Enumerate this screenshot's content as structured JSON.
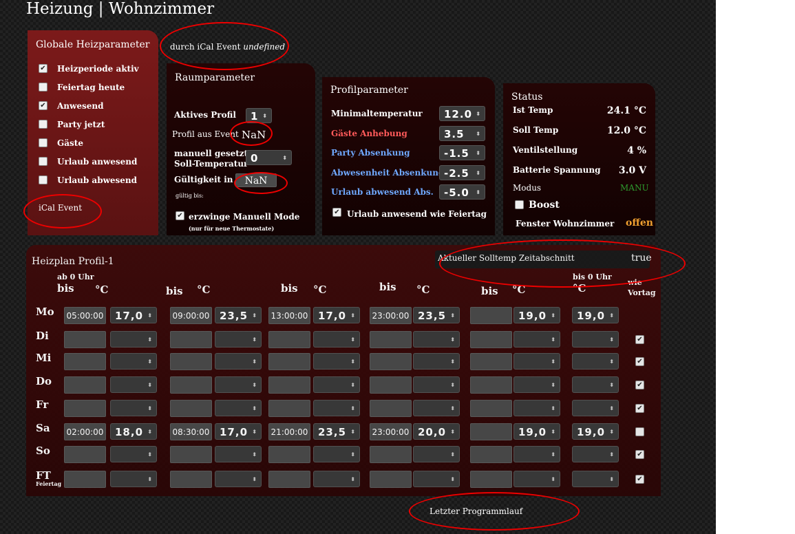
{
  "title": "Heizung | Wohnzimmer",
  "ical_event_top": {
    "prefix": "durch iCal Event",
    "value": "undefined"
  },
  "global": {
    "title": "Globale Heizparameter",
    "items": [
      {
        "label": "Heizperiode aktiv",
        "checked": true
      },
      {
        "label": "Feiertag heute",
        "checked": false
      },
      {
        "label": "Anwesend",
        "checked": true
      },
      {
        "label": "Party jetzt",
        "checked": false
      },
      {
        "label": "Gäste",
        "checked": false
      },
      {
        "label": "Urlaub anwesend",
        "checked": false
      },
      {
        "label": "Urlaub abwesend",
        "checked": false
      }
    ],
    "ical_label": "iCal Event"
  },
  "raum": {
    "title": "Raumparameter",
    "aktives_profil_label": "Aktives Profil",
    "aktives_profil_value": "1",
    "profil_event_label": "Profil aus Event",
    "profil_event_value": "NaN",
    "manuell_label_1": "manuell gesetzte",
    "manuell_label_2": "Soll-Temperatur",
    "manuell_value": "0",
    "gueltigkeit_label": "Gültigkeit in Min",
    "gueltigkeit_value": "NaN",
    "gueltig_bis": "gültig bis:",
    "erzwinge_label": "erzwinge Manuell Mode",
    "erzwinge_note": "(nur für neue Thermostate)",
    "erzwinge_checked": true
  },
  "profil": {
    "title": "Profilparameter",
    "rows": [
      {
        "label": "Minimaltemperatur",
        "value": "12.0",
        "color": "#ffffff"
      },
      {
        "label": "Gäste Anhebung",
        "value": "3.5",
        "color": "#ff5a5a"
      },
      {
        "label": "Party Absenkung",
        "value": "-1.5",
        "color": "#6fa8ff"
      },
      {
        "label": "Abwesenheit Absenkung",
        "value": "-2.5",
        "color": "#6fa8ff"
      },
      {
        "label": "Urlaub abwesend Abs.",
        "value": "-5.0",
        "color": "#6fa8ff"
      }
    ],
    "urlaub_feiertag_label": "Urlaub anwesend wie Feiertag",
    "urlaub_feiertag_checked": true
  },
  "status": {
    "title": "Status",
    "rows": [
      {
        "label": "Ist Temp",
        "value": "24.1 °C"
      },
      {
        "label": "Soll Temp",
        "value": "12.0 °C"
      },
      {
        "label": "Ventilstellung",
        "value": "4 %"
      },
      {
        "label": "Batterie Spannung",
        "value": "3.0 V"
      }
    ],
    "modus_label": "Modus",
    "modus_value": "MANU",
    "modus_color": "#2e9a2e",
    "boost_label": "Boost",
    "fenster_label": "Fenster Wohnzimmer",
    "fenster_value": "offen",
    "fenster_color": "#f0a030"
  },
  "heizplan": {
    "title": "Heizplan Profil-1",
    "aktuell_label": "Aktueller Solltemp Zeitabschnitt",
    "aktuell_value": "true",
    "ab0": "ab 0 Uhr",
    "bis0": "bis 0 Uhr",
    "bis": "bis",
    "degc": "°C",
    "wie_vortag_1": "wie",
    "wie_vortag_2": "Vortag",
    "feiertag_sub": "Feiertag",
    "days": [
      {
        "name": "Mo",
        "times": [
          "05:00:00",
          "09:00:00",
          "13:00:00",
          "23:00:00",
          ""
        ],
        "temps": [
          "17,0",
          "23,5",
          "17,0",
          "23,5",
          "19,0",
          "19,0"
        ],
        "wie": null
      },
      {
        "name": "Di",
        "times": [
          "",
          "",
          "",
          "",
          ""
        ],
        "temps": [
          "",
          "",
          "",
          "",
          "",
          ""
        ],
        "wie": true
      },
      {
        "name": "Mi",
        "times": [
          "",
          "",
          "",
          "",
          ""
        ],
        "temps": [
          "",
          "",
          "",
          "",
          "",
          ""
        ],
        "wie": true
      },
      {
        "name": "Do",
        "times": [
          "",
          "",
          "",
          "",
          ""
        ],
        "temps": [
          "",
          "",
          "",
          "",
          "",
          ""
        ],
        "wie": true
      },
      {
        "name": "Fr",
        "times": [
          "",
          "",
          "",
          "",
          ""
        ],
        "temps": [
          "",
          "",
          "",
          "",
          "",
          ""
        ],
        "wie": true
      },
      {
        "name": "Sa",
        "times": [
          "02:00:00",
          "08:30:00",
          "21:00:00",
          "23:00:00",
          ""
        ],
        "temps": [
          "18,0",
          "17,0",
          "23,5",
          "20,0",
          "19,0",
          "19,0"
        ],
        "wie": false
      },
      {
        "name": "So",
        "times": [
          "",
          "",
          "",
          "",
          ""
        ],
        "temps": [
          "",
          "",
          "",
          "",
          "",
          ""
        ],
        "wie": true
      },
      {
        "name": "FT",
        "times": [
          "",
          "",
          "",
          "",
          ""
        ],
        "temps": [
          "",
          "",
          "",
          "",
          "",
          ""
        ],
        "wie": true
      }
    ]
  },
  "letzter_programmlauf": "Letzter Programmlauf"
}
